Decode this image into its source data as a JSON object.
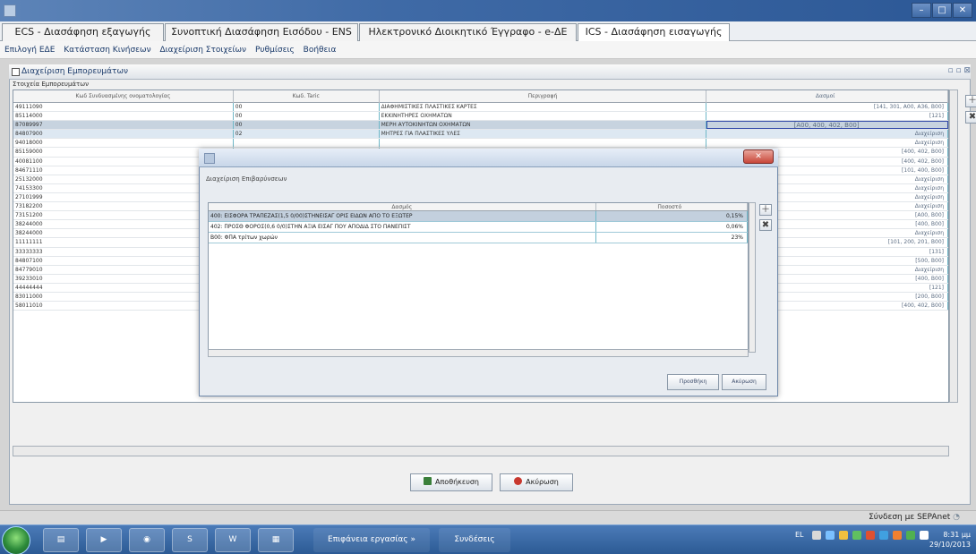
{
  "tabs": [
    {
      "label": "ECS - Διασάφηση εξαγωγής"
    },
    {
      "label": "Συνοπτική Διασάφηση Εισόδου - ENS"
    },
    {
      "label": "Ηλεκτρονικό Διοικητικό Έγγραφο - e-ΔΕ"
    },
    {
      "label": "ICS - Διασάφηση εισαγωγής"
    }
  ],
  "menu": [
    {
      "label": "Επιλογή ΕΔΕ"
    },
    {
      "label": "Κατάσταση Κινήσεων"
    },
    {
      "label": "Διαχείριση Στοιχείων"
    },
    {
      "label": "Ρυθμίσεις"
    },
    {
      "label": "Βοήθεια"
    }
  ],
  "panel": {
    "title": "Διαχείριση Εμπορευμάτων",
    "section_label": "Στοιχεία Εμπορευμάτων"
  },
  "grid": {
    "headers": [
      "Κωδ Συνδυασμένης ονοματολογίας",
      "Κωδ. Taric",
      "Περιγραφή",
      "Δασμοί"
    ],
    "rows": [
      {
        "code": "49111090",
        "taric": "00",
        "desc": "ΔΙΑΦΗΜΙΣΤΙΚΕΣ ΠΛΑΣΤΙΚΕΣ ΚΑΡΤΕΣ",
        "duties": "[141, 301, A00, A36, B00]"
      },
      {
        "code": "85114000",
        "taric": "00",
        "desc": "ΕΚΚΙΝΗΤΗΡΕΣ ΟΧΗΜΑΤΩΝ",
        "duties": "[121]"
      },
      {
        "code": "87089997",
        "taric": "00",
        "desc": "ΜΕΡΗ ΑΥΤΟΚΙΝΗΤΩΝ ΟΧΗΜΑΤΩΝ",
        "duties": "[A00, 400, 402, B00]"
      },
      {
        "code": "84807900",
        "taric": "02",
        "desc": "ΜΗΤΡΕΣ ΓΙΑ ΠΛΑΣΤΙΚΕΣ ΥΛΕΣ",
        "duties": "Διαχείριση"
      },
      {
        "code": "94018000",
        "taric": "",
        "desc": "",
        "duties": "Διαχείριση"
      },
      {
        "code": "85159000",
        "taric": "",
        "desc": "",
        "duties": "[400, 402, B00]"
      },
      {
        "code": "40081100",
        "taric": "",
        "desc": "",
        "duties": "[400, 402, B00]"
      },
      {
        "code": "84671110",
        "taric": "",
        "desc": "",
        "duties": "[101, 400, B00]"
      },
      {
        "code": "25132000",
        "taric": "",
        "desc": "",
        "duties": "Διαχείριση"
      },
      {
        "code": "74153300",
        "taric": "",
        "desc": "",
        "duties": "Διαχείριση"
      },
      {
        "code": "27101999",
        "taric": "",
        "desc": "",
        "duties": "Διαχείριση"
      },
      {
        "code": "73182200",
        "taric": "",
        "desc": "",
        "duties": "Διαχείριση"
      },
      {
        "code": "73151200",
        "taric": "",
        "desc": "",
        "duties": "[A00, B00]"
      },
      {
        "code": "38244000",
        "taric": "",
        "desc": "",
        "duties": "[400, B00]"
      },
      {
        "code": "38244000",
        "taric": "",
        "desc": "",
        "duties": "Διαχείριση"
      },
      {
        "code": "11111111",
        "taric": "",
        "desc": "",
        "duties": "[101, 200, 201, B00]"
      },
      {
        "code": "33333333",
        "taric": "",
        "desc": "",
        "duties": "[131]"
      },
      {
        "code": "84807100",
        "taric": "",
        "desc": "",
        "duties": "[500, B00]"
      },
      {
        "code": "84779010",
        "taric": "",
        "desc": "",
        "duties": "Διαχείριση"
      },
      {
        "code": "39233010",
        "taric": "",
        "desc": "",
        "duties": "[400, B00]"
      },
      {
        "code": "44444444",
        "taric": "",
        "desc": "",
        "duties": "[121]"
      },
      {
        "code": "83011000",
        "taric": "",
        "desc": "",
        "duties": "[200, B00]"
      },
      {
        "code": "58011010",
        "taric": "",
        "desc": "",
        "duties": "[400, 402, B00]"
      }
    ]
  },
  "buttons": {
    "save": "Αποθήκευση",
    "cancel": "Ακύρωση"
  },
  "modal": {
    "section_label": "Διαχείριση Επιβαρύνσεων",
    "headers": [
      "Δασμός",
      "Ποσοστό"
    ],
    "rows": [
      {
        "duty": "400: ΕΙΣΦΟΡΑ ΤΡΑΠΕΖΑΣ(1,5 0/00)ΣΤΗΝΕΙΣΑΓ ΟΡΙΣ ΕΙΔΩΝ ΑΠΟ ΤΟ ΕΞΩΤΕΡ",
        "pct": "0,15%"
      },
      {
        "duty": "402: ΠΡΟΣΘ ΦΟΡΟΣ(0,6 0/0)ΣΤΗΝ ΑΞΙΑ ΕΙΣΑΓ ΠΟΥ ΑΠΟΔΙΔ ΣΤΟ ΠΑΝΕΠΙΣΤ",
        "pct": "0,06%"
      },
      {
        "duty": "B00: ΦΠΑ τρίτων χωρών",
        "pct": "23%"
      }
    ],
    "add": "Προσθήκη",
    "cancel": "Ακύρωση"
  },
  "status": "Σύνδεση με SEPAnet",
  "taskbar": {
    "desktop": "Επιφάνεια εργασίας",
    "links": "Συνδέσεις",
    "lang": "EL",
    "time": "8:31 μμ",
    "date": "29/10/2013"
  },
  "colors": {
    "accent": "#3f6aa6",
    "selection": "#c7d3df",
    "grid_border": "#70b8c8"
  }
}
